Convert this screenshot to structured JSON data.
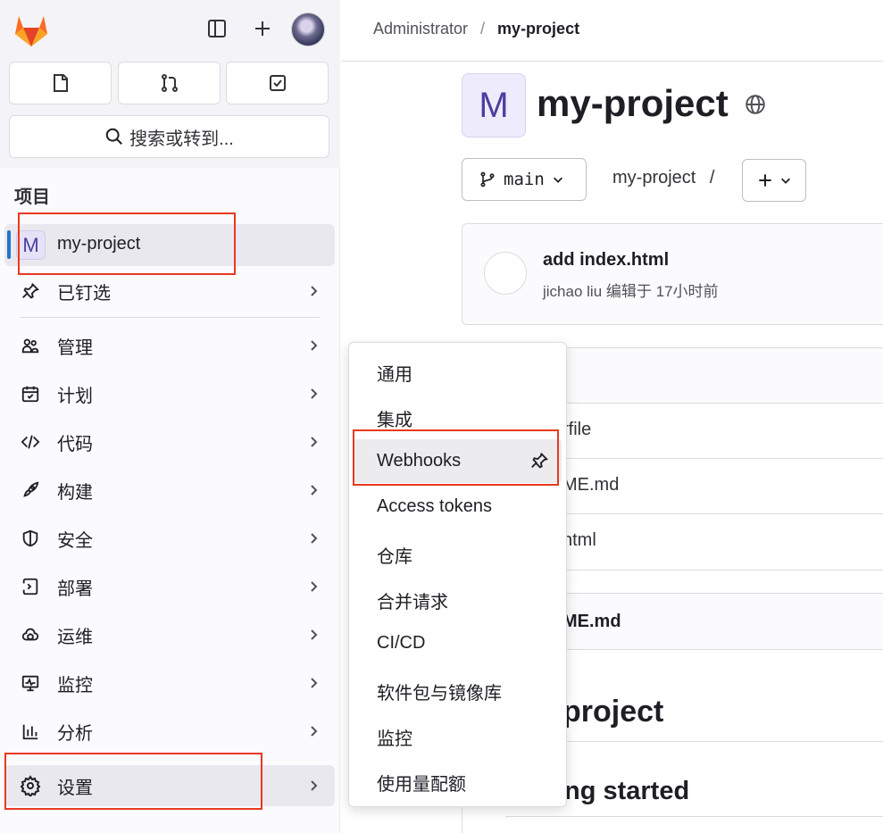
{
  "sidebar": {
    "search_label": "搜索或转到...",
    "section_title": "项目",
    "project_badge": "M",
    "project_name": "my-project",
    "pinned_label": "已钉选",
    "items": [
      {
        "label": "管理",
        "icon": "users-icon"
      },
      {
        "label": "计划",
        "icon": "calendar-icon"
      },
      {
        "label": "代码",
        "icon": "code-icon"
      },
      {
        "label": "构建",
        "icon": "rocket-icon"
      },
      {
        "label": "安全",
        "icon": "shield-icon"
      },
      {
        "label": "部署",
        "icon": "deploy-icon"
      },
      {
        "label": "运维",
        "icon": "cloud-icon"
      },
      {
        "label": "监控",
        "icon": "monitor-icon"
      },
      {
        "label": "分析",
        "icon": "chart-icon"
      },
      {
        "label": "设置",
        "icon": "gear-icon"
      }
    ]
  },
  "breadcrumb": {
    "parent": "Administrator",
    "separator": "/",
    "current": "my-project"
  },
  "project": {
    "badge": "M",
    "title": "my-project",
    "branch": "main",
    "path": "my-project",
    "path_sep": "/",
    "plus": "+"
  },
  "commit": {
    "title": "add index.html",
    "author": "jichao liu",
    "meta": "编辑于 17小时前"
  },
  "files": [
    "rfile",
    "ME.md",
    "html"
  ],
  "readme": {
    "header": "ME.md",
    "h1": "project",
    "h2": "ng started"
  },
  "flyout": {
    "items": [
      "通用",
      "集成",
      "Webhooks",
      "Access tokens",
      "仓库",
      "合并请求",
      "CI/CD",
      "软件包与镜像库",
      "监控",
      "使用量配额"
    ],
    "highlighted": "Webhooks"
  },
  "colors": {
    "accent": "#1f75cb",
    "highlight_box": "#e8391f",
    "logo_orange": "#e24329"
  }
}
